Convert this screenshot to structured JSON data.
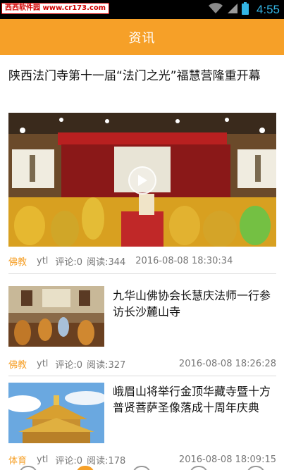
{
  "status_bar": {
    "watermark": "西西软件园 www.cr173.com",
    "time": "4:55",
    "icons": [
      "wifi-icon",
      "signal-icon",
      "battery-icon"
    ]
  },
  "header": {
    "title": "资讯"
  },
  "articles": [
    {
      "title": "陕西法门寺第十一届“法门之光”福慧营隆重开幕",
      "category": "佛教",
      "author": "ytl",
      "comments": "评论:0",
      "reads": "阅读:344",
      "date": "2016-08-08 18:30:34",
      "has_video": true
    },
    {
      "title": "九华山佛协会长慧庆法师一行参访长沙麓山寺",
      "category": "佛教",
      "author": "ytl",
      "comments": "评论:0",
      "reads": "阅读:327",
      "date": "2016-08-08 18:26:28"
    },
    {
      "title": "峨眉山将举行金顶华藏寺暨十方普贤菩萨圣像落成十周年庆典",
      "category": "体育",
      "author": "ytl",
      "comments": "评论:0",
      "reads": "阅读:178",
      "date": "2016-08-08 18:09:15"
    }
  ],
  "bottom_nav": [
    "nav-tab-1",
    "nav-tab-2",
    "nav-tab-3",
    "nav-tab-4",
    "nav-tab-5"
  ],
  "colors": {
    "accent": "#f6a028",
    "status_time": "#33b5e5",
    "status_bg": "#000000"
  }
}
